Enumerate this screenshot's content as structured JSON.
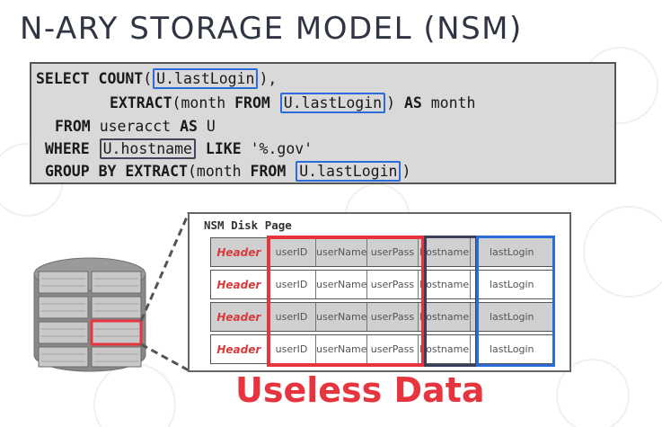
{
  "slide": {
    "title": "N-ARY STORAGE MODEL (NSM)"
  },
  "sql": {
    "kw_select": "SELECT",
    "kw_count": "COUNT",
    "paren_open": "(",
    "after_count": "),",
    "kw_extract": "EXTRACT",
    "paren_month": "(month",
    "kw_from": "FROM",
    "close_paren": ")",
    "kw_as": "AS",
    "alias_month": "month",
    "table_name": "useracct",
    "alias_u": "U",
    "kw_where": "WHERE",
    "kw_like": "LIKE",
    "pattern": "'%.gov'",
    "kw_group_by": "GROUP BY",
    "highlight_lastlogin": "U.lastLogin",
    "highlight_hostname": "U.hostname"
  },
  "page": {
    "label": "NSM Disk Page",
    "header_cell": "Header",
    "columns": [
      "userID",
      "userName",
      "userPass",
      "hostname",
      "lastLogin"
    ]
  },
  "caption": {
    "useless": "Useless Data"
  },
  "colors": {
    "title": "#2f3542",
    "red": "#e6353f",
    "blue": "#2a6dd9",
    "dark": "#3b3e5a",
    "sql_bg": "#d9d9d9"
  }
}
